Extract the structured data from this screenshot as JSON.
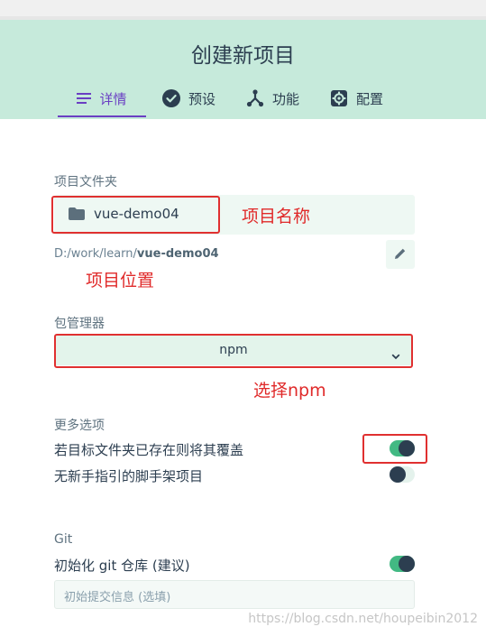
{
  "header": {
    "title": "创建新项目",
    "tabs": [
      {
        "label": "详情",
        "icon": "list-icon",
        "active": true
      },
      {
        "label": "预设",
        "icon": "check-circle-icon"
      },
      {
        "label": "功能",
        "icon": "fork-icon"
      },
      {
        "label": "配置",
        "icon": "gear-icon"
      }
    ]
  },
  "form": {
    "folder_label": "项目文件夹",
    "folder_value": "vue-demo04",
    "path_prefix": "D:/work/learn/",
    "path_name": "vue-demo04",
    "package_manager_label": "包管理器",
    "package_manager_value": "npm",
    "more_options_label": "更多选项",
    "overwrite_label": "若目标文件夹已存在则将其覆盖",
    "overwrite_on": true,
    "no_guide_label": "无新手指引的脚手架项目",
    "no_guide_on": false,
    "git_label": "Git",
    "git_init_label": "初始化 git 仓库 (建议)",
    "git_init_on": true,
    "commit_placeholder": "初始提交信息 (选填)"
  },
  "annotations": {
    "project_name": "项目名称",
    "project_location": "项目位置",
    "select_npm": "选择npm"
  },
  "watermark": "https://blog.csdn.net/houpeibin2012",
  "colors": {
    "header_bg": "#c6eadb",
    "accent": "#6a3fc3",
    "toggle_on": "#42b983",
    "annotation_red": "#e03030"
  }
}
